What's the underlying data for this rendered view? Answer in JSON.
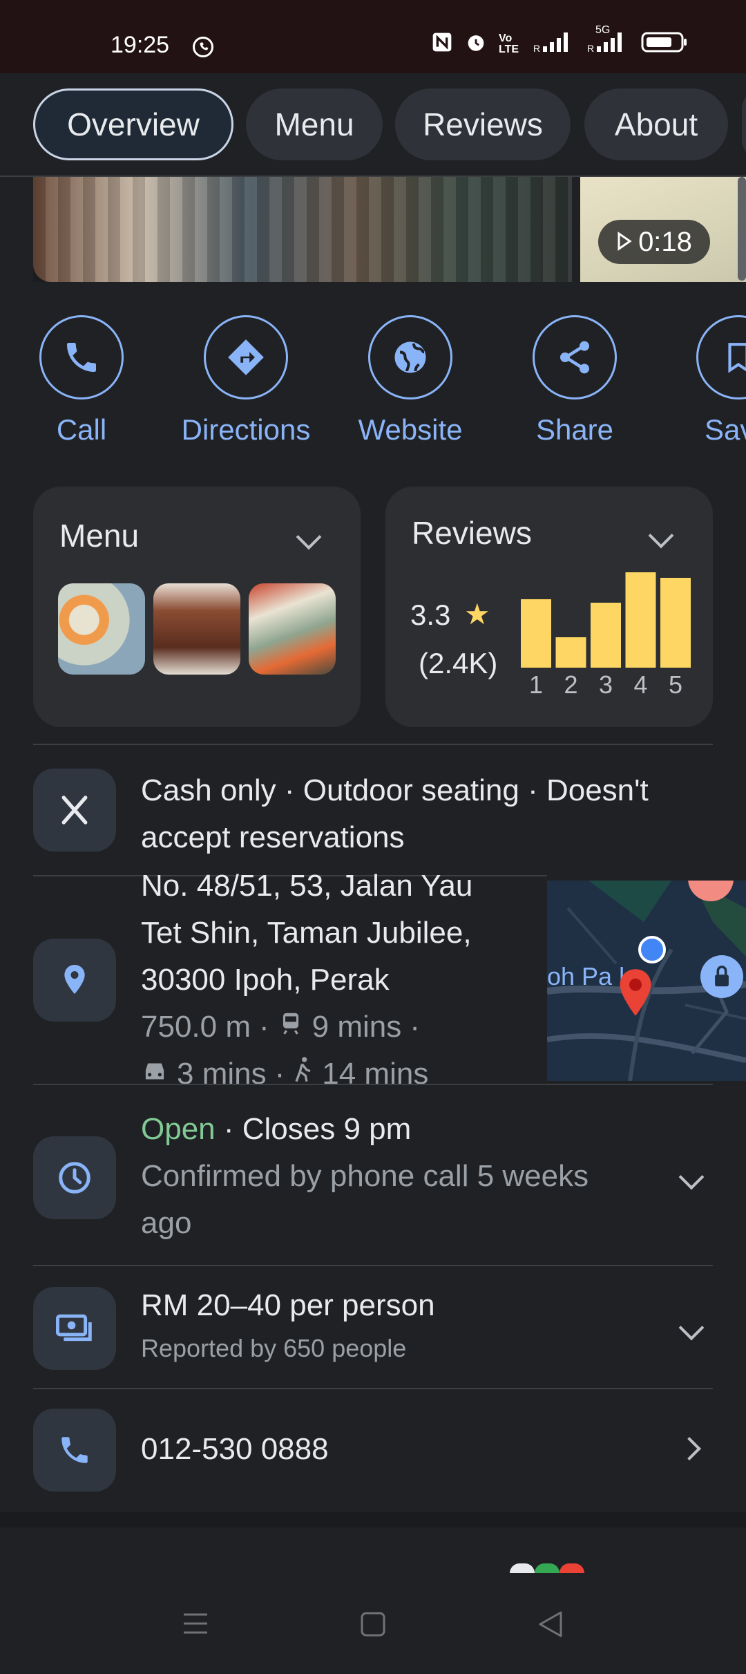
{
  "status_bar": {
    "time": "19:25",
    "icons": [
      "whatsapp-icon",
      "nfc-icon",
      "alarm-icon",
      "volte-icon",
      "signal-icon",
      "5g-signal-icon",
      "battery-icon"
    ],
    "volte_text": "Vo LTE",
    "net_text": "5G"
  },
  "tabs": [
    {
      "label": "Overview",
      "active": true
    },
    {
      "label": "Menu",
      "active": false
    },
    {
      "label": "Reviews",
      "active": false
    },
    {
      "label": "About",
      "active": false
    }
  ],
  "photos": {
    "video_duration": "0:18"
  },
  "actions": [
    {
      "label": "Call",
      "icon": "phone-icon"
    },
    {
      "label": "Directions",
      "icon": "directions-icon"
    },
    {
      "label": "Website",
      "icon": "globe-icon"
    },
    {
      "label": "Share",
      "icon": "share-icon"
    },
    {
      "label": "Sav",
      "icon": "bookmark-icon"
    }
  ],
  "menu_card": {
    "title": "Menu"
  },
  "reviews_card": {
    "title": "Reviews",
    "rating": "3.3",
    "count": "(2.4K)",
    "star_color": "#fdd663",
    "distribution": [
      {
        "stars": "1",
        "fraction": 0.72
      },
      {
        "stars": "2",
        "fraction": 0.32
      },
      {
        "stars": "3",
        "fraction": 0.68
      },
      {
        "stars": "4",
        "fraction": 1.0
      },
      {
        "stars": "5",
        "fraction": 0.94
      }
    ]
  },
  "info": {
    "amenities": {
      "icon": "restaurant-icon",
      "line1": "Cash only · Outdoor seating · Doesn't",
      "line2": "accept reservations"
    },
    "address": {
      "icon": "location-pin-icon",
      "line1": "No. 48/51, 53, Jalan Yau",
      "line2": "Tet Shin, Taman Jubilee,",
      "line3": "30300 Ipoh, Perak",
      "distance": "750.0 m",
      "transit": "9 mins",
      "drive": "3 mins",
      "walk": "14 mins",
      "map_label": "oh Pa    le"
    },
    "hours": {
      "icon": "clock-icon",
      "status": "Open",
      "status_color": "#81c995",
      "closes": " · Closes 9 pm",
      "note_line1": "Confirmed by phone call 5 weeks",
      "note_line2": "ago"
    },
    "price": {
      "icon": "money-icon",
      "range": "RM 20–40 per person",
      "reported": "Reported by 650 people"
    },
    "phone": {
      "icon": "phone-icon",
      "number": "012-530 0888"
    }
  },
  "colors": {
    "accent": "#8ab4f8",
    "background": "#202124",
    "bar": "#fdd663"
  }
}
